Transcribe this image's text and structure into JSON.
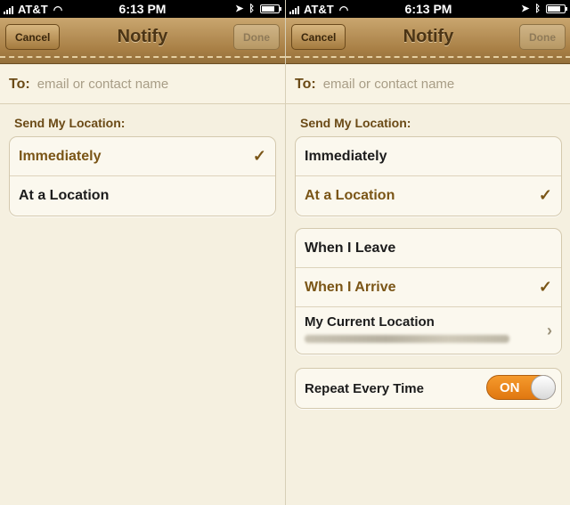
{
  "status_bar": {
    "carrier": "AT&T",
    "time": "6:13 PM"
  },
  "screens": [
    {
      "nav": {
        "cancel_label": "Cancel",
        "title": "Notify",
        "done_label": "Done"
      },
      "to": {
        "label": "To:",
        "placeholder": "email or contact name"
      },
      "section_header": "Send My Location:",
      "options": [
        {
          "label": "Immediately",
          "selected": true
        },
        {
          "label": "At a Location",
          "selected": false
        }
      ]
    },
    {
      "nav": {
        "cancel_label": "Cancel",
        "title": "Notify",
        "done_label": "Done"
      },
      "to": {
        "label": "To:",
        "placeholder": "email or contact name"
      },
      "section_header": "Send My Location:",
      "options": [
        {
          "label": "Immediately",
          "selected": false
        },
        {
          "label": "At a Location",
          "selected": true
        }
      ],
      "location_options": [
        {
          "label": "When I Leave",
          "selected": false
        },
        {
          "label": "When I Arrive",
          "selected": true
        }
      ],
      "current_location": {
        "label": "My Current Location"
      },
      "repeat": {
        "label": "Repeat Every Time",
        "state": "ON"
      }
    }
  ],
  "glyphs": {
    "check": "✓",
    "chevron": "›"
  },
  "colors": {
    "accent": "#7a5516",
    "toggle_on": "#f08a1e",
    "nav_leather": "#b08a50"
  }
}
